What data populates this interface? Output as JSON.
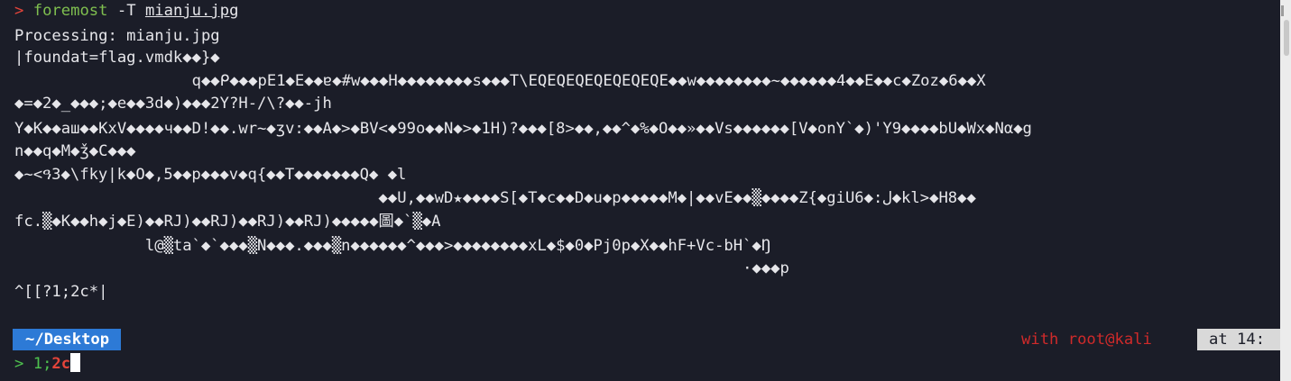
{
  "terminal": {
    "command_line": {
      "prompt_symbol": ">",
      "command": "foremost",
      "flag": "-T",
      "file": "mianju.jpg"
    },
    "output_lines": [
      "Processing: mianju.jpg",
      "|foundat=flag.vmdk◆◆}◆",
      "                   q◆◆ᑭ◆◆◆pE1◆E◆◆ɐ◆#w◆◆◆H◆◆◆◆◆◆◆◆s◆◆◆T\\EQEQEQEQEQEQEQE◆◆w◆◆◆◆◆◆◆◆~◆◆◆◆◆◆4◆◆E◆◆c◆Zoz◆6◆◆X",
      "◆=◆2◆_◆◆◆;◆e◆◆3d◆)◆◆◆2Y?H-/\\?◆◆-jh",
      "Y◆K◆◆aш◆◆KxV◆◆◆◆ч◆◆D!◆◆.wr~◆ʒv:◆◆A◆>◆BV<◆99o◆◆N◆>◆1H)?◆◆◆[8>◆◆,◆◆^◆%◆O◆◆»◆◆Vs◆◆◆◆◆◆[V◆onY`◆)'Y9◆◆◆◆bU◆Wx◆Nα◆g",
      "n◆◆q◆M◆ǯ◆C◆◆◆",
      "◆~<ዓ3◆\\fky|k◆O◆,5◆◆p◆◆◆v◆q{◆◆T◆◆◆◆◆◆◆Q◆ ◆l",
      "                                       ◆◆U,◆◆wD★◆◆◆◆S[◆T◆c◆◆D◆u◆p◆◆◆◆◆M◆|◆◆vE◆◆▒◆◆◆◆Z{◆giU6◆:ل◆kl>◆H8◆◆",
      "fc.▒◆K◆◆h◆j◆E)◆◆RJ)◆◆RJ)◆◆RJ)◆◆RJ)◆◆◆◆◆圖◆`▒◆A",
      "              l@▒ta`◆`◆◆◆▒N◆◆◆.◆◆◆▒n◆◆◆◆◆◆^◆◆◆>◆◆◆◆◆◆◆◆xL◆$◆0◆Pj0p◆X◆◆hF+Vc-bH`◆Ŋ",
      "                                                                              ·◆◆◆p",
      "^[[?1;2c*|"
    ],
    "status": {
      "directory": "~/Desktop",
      "user_info": "with root@kali",
      "time_label": "at 14:"
    },
    "input_line": {
      "prompt_symbol": ">",
      "typed_normal": "1;",
      "typed_red": "2c"
    }
  }
}
